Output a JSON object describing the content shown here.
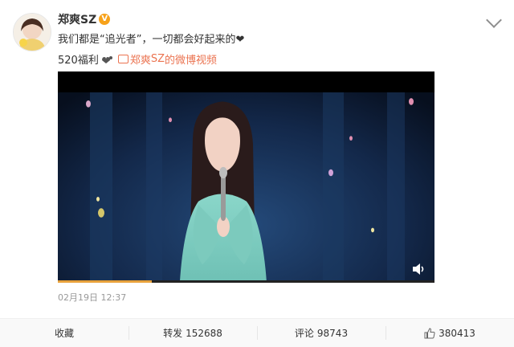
{
  "author": {
    "name": "郑爽SZ",
    "verified_badge": "V",
    "avatar": "avatar-image"
  },
  "post": {
    "line1": "我们都是“追光者”，一切都会好起来的❤",
    "line2_prefix": "520福利",
    "line2_prefix_icon": "hug-emoji",
    "video_link_icon": "video-icon",
    "video_link_author": "郑爽",
    "video_link_author2": "SZ",
    "video_link_suffix": "的微博视频"
  },
  "video": {
    "progress_fraction": 0.25,
    "speaker_icon": "volume-icon"
  },
  "timestamp": "02月19日 12:37",
  "actions": [
    {
      "label": "收藏",
      "count": ""
    },
    {
      "label": "转发",
      "count": "152688"
    },
    {
      "label": "评论",
      "count": "98743"
    },
    {
      "label": "",
      "count": "380413",
      "icon": "thumbs-up-icon"
    }
  ],
  "colors": {
    "accent": "#eb7350",
    "verify": "#f7a21b",
    "progress": "#e8a23c"
  }
}
